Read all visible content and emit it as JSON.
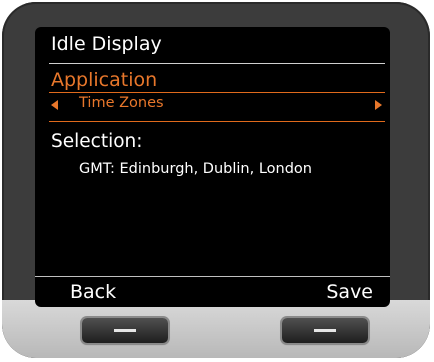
{
  "screen": {
    "title": "Idle Display",
    "application": {
      "label": "Application",
      "value": "Time Zones",
      "left_arrow_icon": "left-triangle-icon",
      "right_arrow_icon": "right-triangle-icon"
    },
    "selection": {
      "label": "Selection:",
      "value": "GMT: Edinburgh, Dublin, London"
    },
    "softkeys": {
      "left": "Back",
      "right": "Save"
    }
  },
  "colors": {
    "accent": "#e8772b",
    "screen_bg": "#000000",
    "text": "#ffffff",
    "device_body": "#3c3c3c"
  }
}
